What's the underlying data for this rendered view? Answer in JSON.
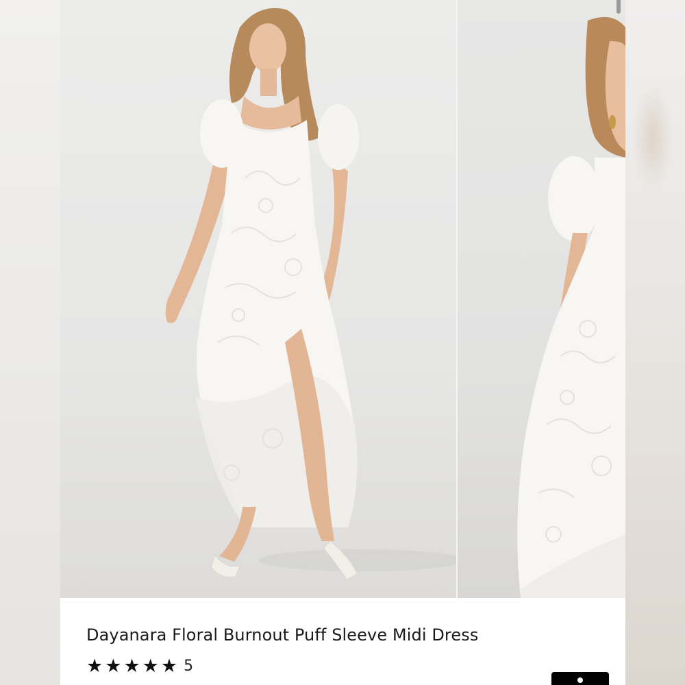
{
  "product": {
    "name": "Dayanara Floral Burnout Puff Sleeve Midi Dress",
    "rating_count": "5",
    "rating_stars": 5,
    "star_glyph": "★"
  },
  "carousel": {
    "slides": [
      "product-photo-front",
      "product-photo-side"
    ],
    "active_slide": 1
  },
  "colors": {
    "background": "#ecebea",
    "dress": "#f7f6f3",
    "button": "#000000"
  },
  "icons": {
    "star": "star-icon",
    "bag": "bag-icon"
  }
}
